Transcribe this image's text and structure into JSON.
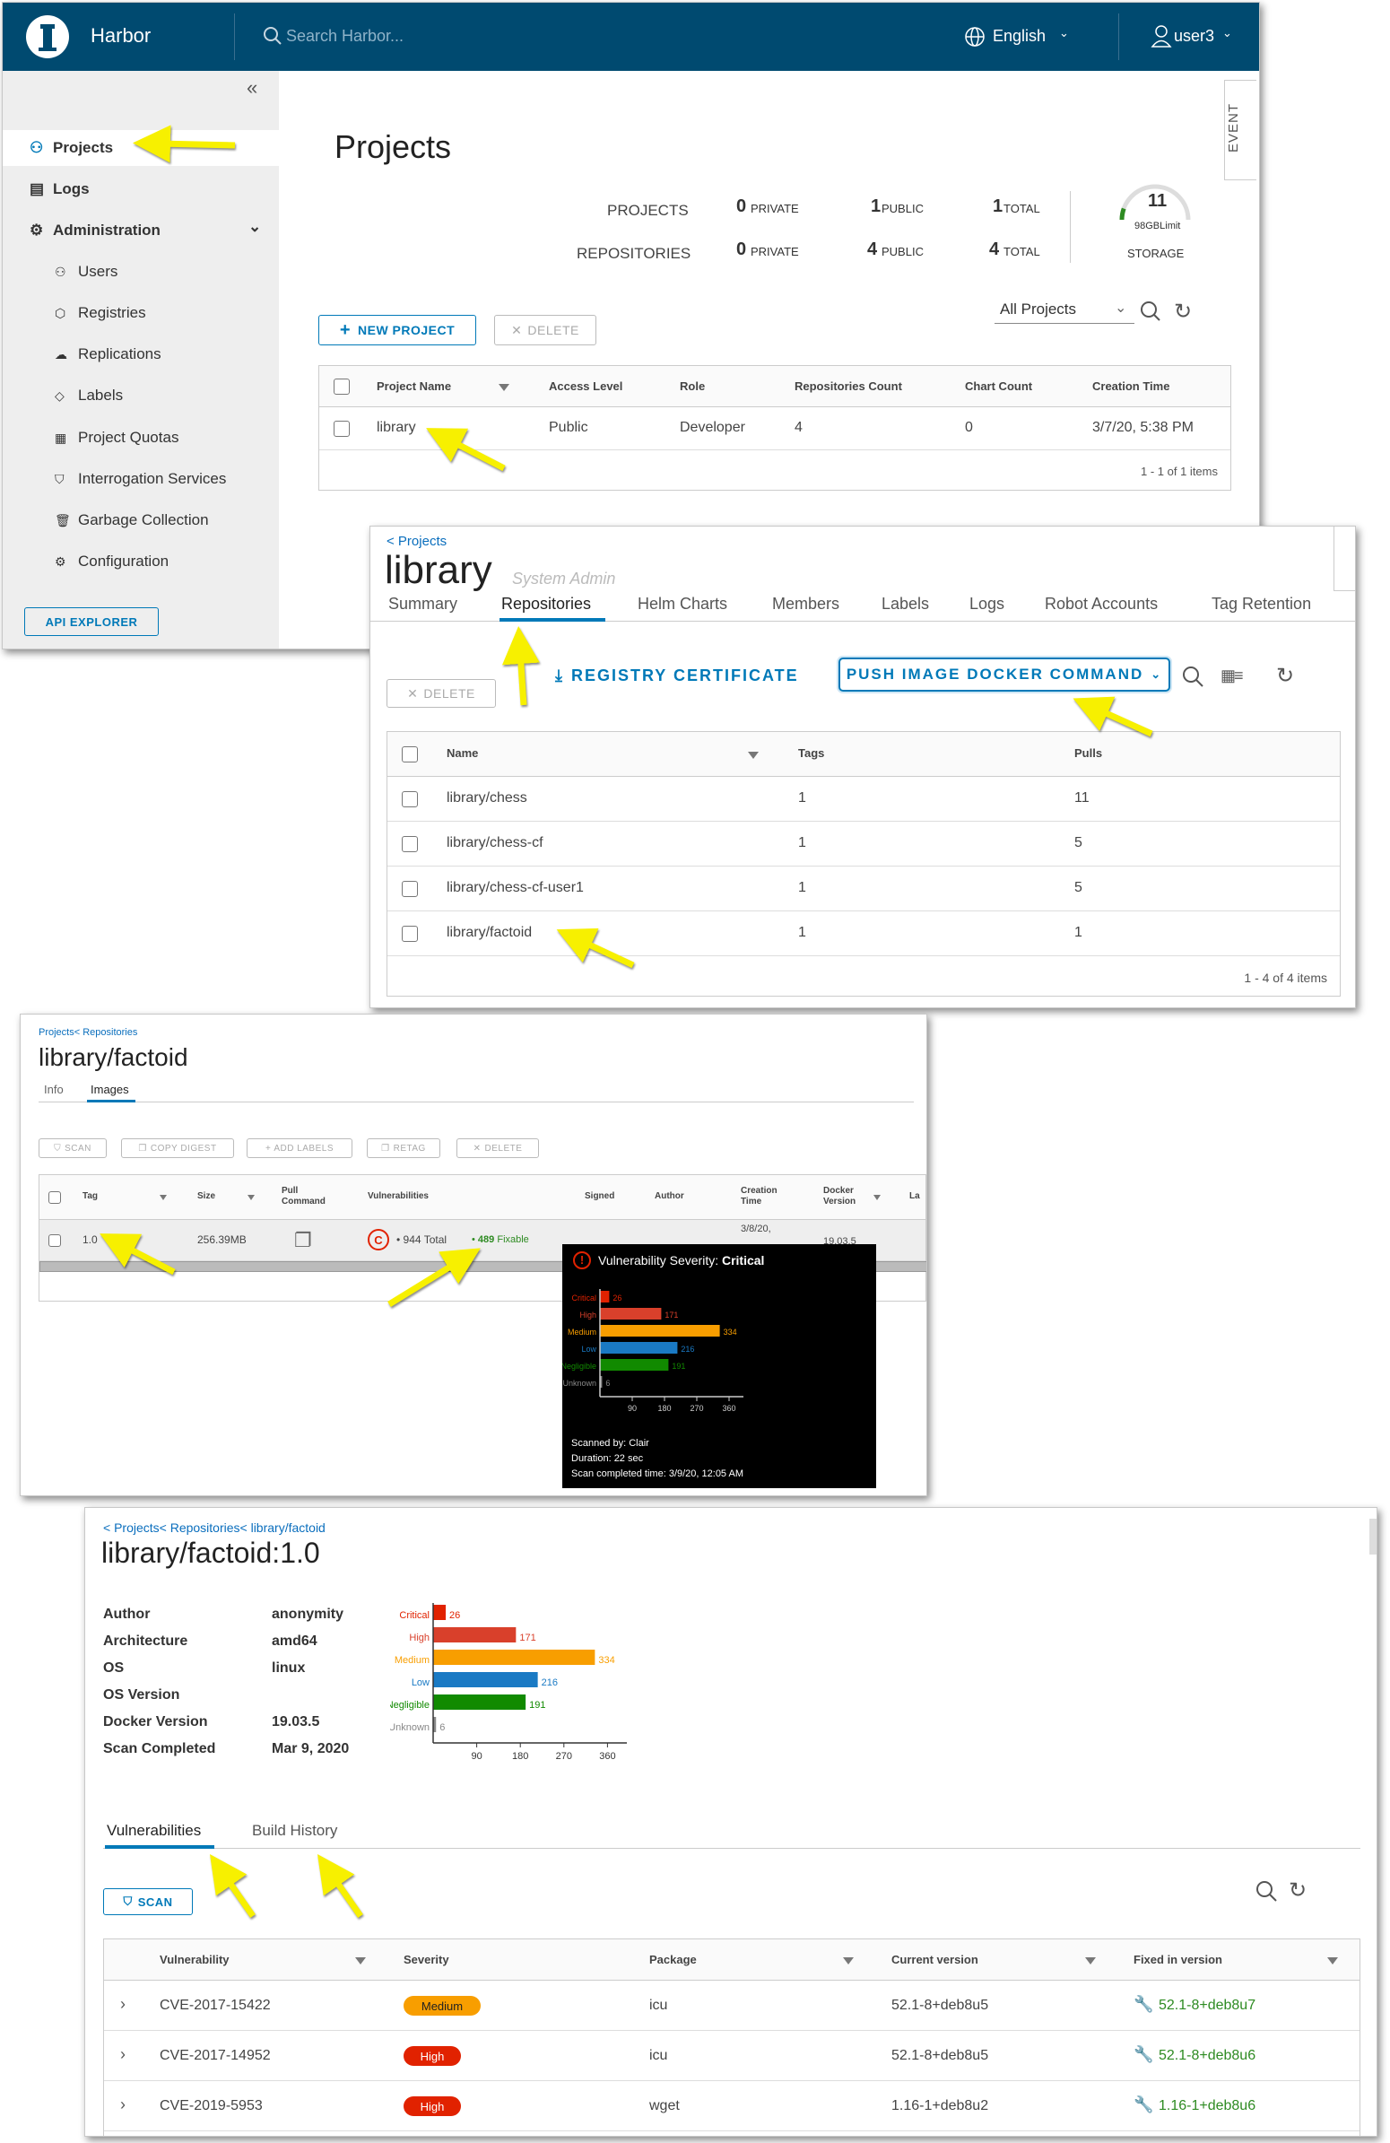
{
  "p1": {
    "brand": "Harbor",
    "search_placeholder": "Search Harbor...",
    "language": "English",
    "user": "user3",
    "sidebar": {
      "projects": "Projects",
      "logs": "Logs",
      "administration": "Administration",
      "users": "Users",
      "registries": "Registries",
      "replications": "Replications",
      "labels": "Labels",
      "project_quotas": "Project Quotas",
      "interrogation": "Interrogation Services",
      "garbage": "Garbage Collection",
      "configuration": "Configuration",
      "api_explorer": "API EXPLORER"
    },
    "event_tab": "EVENT",
    "title": "Projects",
    "summary": {
      "projects_label": "PROJECTS",
      "repositories_label": "REPOSITORIES",
      "proj_private_n": "0",
      "proj_public_n": "1",
      "proj_total_n": "1",
      "repo_private_n": "0",
      "repo_public_n": "4",
      "repo_total_n": "4",
      "private": "PRIVATE",
      "public": "PUBLIC",
      "total": "TOTAL",
      "storage_value": "11",
      "storage_limit": "98GBLimit",
      "storage_label": "STORAGE",
      "storage_fraction": 0.11
    },
    "new_project": "NEW PROJECT",
    "delete": "DELETE",
    "filter_select": "All Projects",
    "table": {
      "headers": [
        "Project Name",
        "Access Level",
        "Role",
        "Repositories Count",
        "Chart Count",
        "Creation Time"
      ],
      "row": [
        "library",
        "Public",
        "Developer",
        "4",
        "0",
        "3/7/20, 5:38 PM"
      ],
      "footer": "1 - 1 of 1 items"
    }
  },
  "p2": {
    "breadcrumb": "< Projects",
    "title": "library",
    "role": "System Admin",
    "tabs": [
      "Summary",
      "Repositories",
      "Helm Charts",
      "Members",
      "Labels",
      "Logs",
      "Robot Accounts",
      "Tag Retention"
    ],
    "delete": "DELETE",
    "registry_cert": "REGISTRY CERTIFICATE",
    "push_cmd": "PUSH IMAGE DOCKER COMMAND",
    "headers": [
      "Name",
      "Tags",
      "Pulls"
    ],
    "rows": [
      [
        "library/chess",
        "1",
        "11"
      ],
      [
        "library/chess-cf",
        "1",
        "5"
      ],
      [
        "library/chess-cf-user1",
        "1",
        "5"
      ],
      [
        "library/factoid",
        "1",
        "1"
      ]
    ],
    "footer": "1 - 4 of 4 items"
  },
  "p3": {
    "breadcrumb": "Projects< Repositories",
    "title": "library/factoid",
    "tabs": [
      "Info",
      "Images"
    ],
    "buttons": [
      "SCAN",
      "COPY DIGEST",
      "ADD LABELS",
      "RETAG",
      "DELETE"
    ],
    "headers": [
      "Tag",
      "Size",
      "Pull Command",
      "Vulnerabilities",
      "Signed",
      "Author",
      "Creation Time",
      "Docker Version",
      "La"
    ],
    "row": {
      "tag": "1.0",
      "size": "256.39MB",
      "severity_letter": "C",
      "total": "944",
      "total_label": "Total",
      "fixable": "489",
      "fixable_label": "Fixable",
      "creation": "3/8/20,",
      "docker": "19.03.5"
    },
    "tooltip": {
      "title": "Vulnerability Severity:",
      "severity": "Critical",
      "scanned_by": "Scanned by: Clair",
      "duration": "Duration: 22 sec",
      "completed": "Scan completed time: 3/9/20, 12:05 AM"
    }
  },
  "p4": {
    "breadcrumb": "< Projects< Repositories< library/factoid",
    "title": "library/factoid:1.0",
    "details": [
      [
        "Author",
        "anonymity"
      ],
      [
        "Architecture",
        "amd64"
      ],
      [
        "OS",
        "linux"
      ],
      [
        "OS Version",
        ""
      ],
      [
        "Docker Version",
        "19.03.5"
      ],
      [
        "Scan Completed",
        "Mar 9, 2020"
      ]
    ],
    "tabs": [
      "Vulnerabilities",
      "Build History"
    ],
    "scan": "SCAN",
    "headers": [
      "Vulnerability",
      "Severity",
      "Package",
      "Current version",
      "Fixed in version"
    ],
    "rows": [
      [
        "CVE-2017-15422",
        "Medium",
        "icu",
        "52.1-8+deb8u5",
        "52.1-8+deb8u7"
      ],
      [
        "CVE-2017-14952",
        "High",
        "icu",
        "52.1-8+deb8u5",
        "52.1-8+deb8u6"
      ],
      [
        "CVE-2019-5953",
        "High",
        "wget",
        "1.16-1+deb8u2",
        "1.16-1+deb8u6"
      ]
    ]
  },
  "chart_data": [
    {
      "type": "bar",
      "orientation": "horizontal",
      "categories": [
        "Critical",
        "High",
        "Medium",
        "Low",
        "Negligible",
        "Unknown"
      ],
      "values": [
        26,
        171,
        334,
        216,
        191,
        6
      ],
      "colors": [
        "#e12200",
        "#d9402b",
        "#f89e00",
        "#1a7ac4",
        "#118a00",
        "#888888"
      ],
      "xticks": [
        "90",
        "180",
        "270",
        "360"
      ],
      "xlim": [
        0,
        400
      ],
      "xlabel": "",
      "ylabel": ""
    },
    {
      "type": "bar",
      "orientation": "horizontal",
      "categories": [
        "Critical",
        "High",
        "Medium",
        "Low",
        "Negligible",
        "Unknown"
      ],
      "values": [
        26,
        171,
        334,
        216,
        191,
        6
      ],
      "colors": [
        "#e12200",
        "#d9402b",
        "#f89e00",
        "#1a7ac4",
        "#118a00",
        "#888888"
      ],
      "xticks": [
        "90",
        "180",
        "270",
        "360"
      ],
      "xlim": [
        0,
        400
      ],
      "xlabel": "",
      "ylabel": ""
    }
  ]
}
